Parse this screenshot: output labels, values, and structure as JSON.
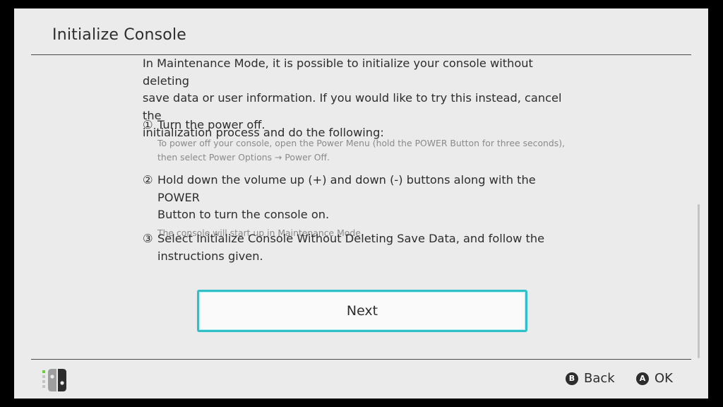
{
  "header": {
    "title": "Initialize Console"
  },
  "content": {
    "intro_lines": [
      "In Maintenance Mode, it is possible to initialize your console without deleting",
      "save data or user information. If you would like to try this instead, cancel the",
      "initialization process and do the following:"
    ],
    "steps": [
      {
        "number": "①",
        "text_lines": [
          "Turn the power off."
        ],
        "note_lines": [
          "To power off your console, open the Power Menu (hold the POWER Button for three seconds),",
          "then select Power Options → Power Off."
        ]
      },
      {
        "number": "②",
        "text_lines": [
          "Hold down the volume up (+) and down (-) buttons along with the POWER",
          "Button to turn the console on."
        ],
        "note_lines": [
          "The console will start up in Maintenance Mode."
        ]
      },
      {
        "number": "③",
        "text_lines": [
          "Select Initialize Console Without Deleting Save Data, and follow the",
          "instructions given."
        ],
        "note_lines": []
      }
    ]
  },
  "primary_button": {
    "label": "Next"
  },
  "footer": {
    "controller_icon": "joy-con-icon",
    "actions": [
      {
        "glyph": "B",
        "label": "Back"
      },
      {
        "glyph": "A",
        "label": "OK"
      }
    ]
  },
  "colors": {
    "background": "#ebebeb",
    "text": "#2d2d2d",
    "note_text": "#8a8a8a",
    "focus_border": "#2fc0c9",
    "joycon_left": "#9e9e9e",
    "joycon_right": "#2d2d2d",
    "indicator_green": "#6ecf3a"
  }
}
